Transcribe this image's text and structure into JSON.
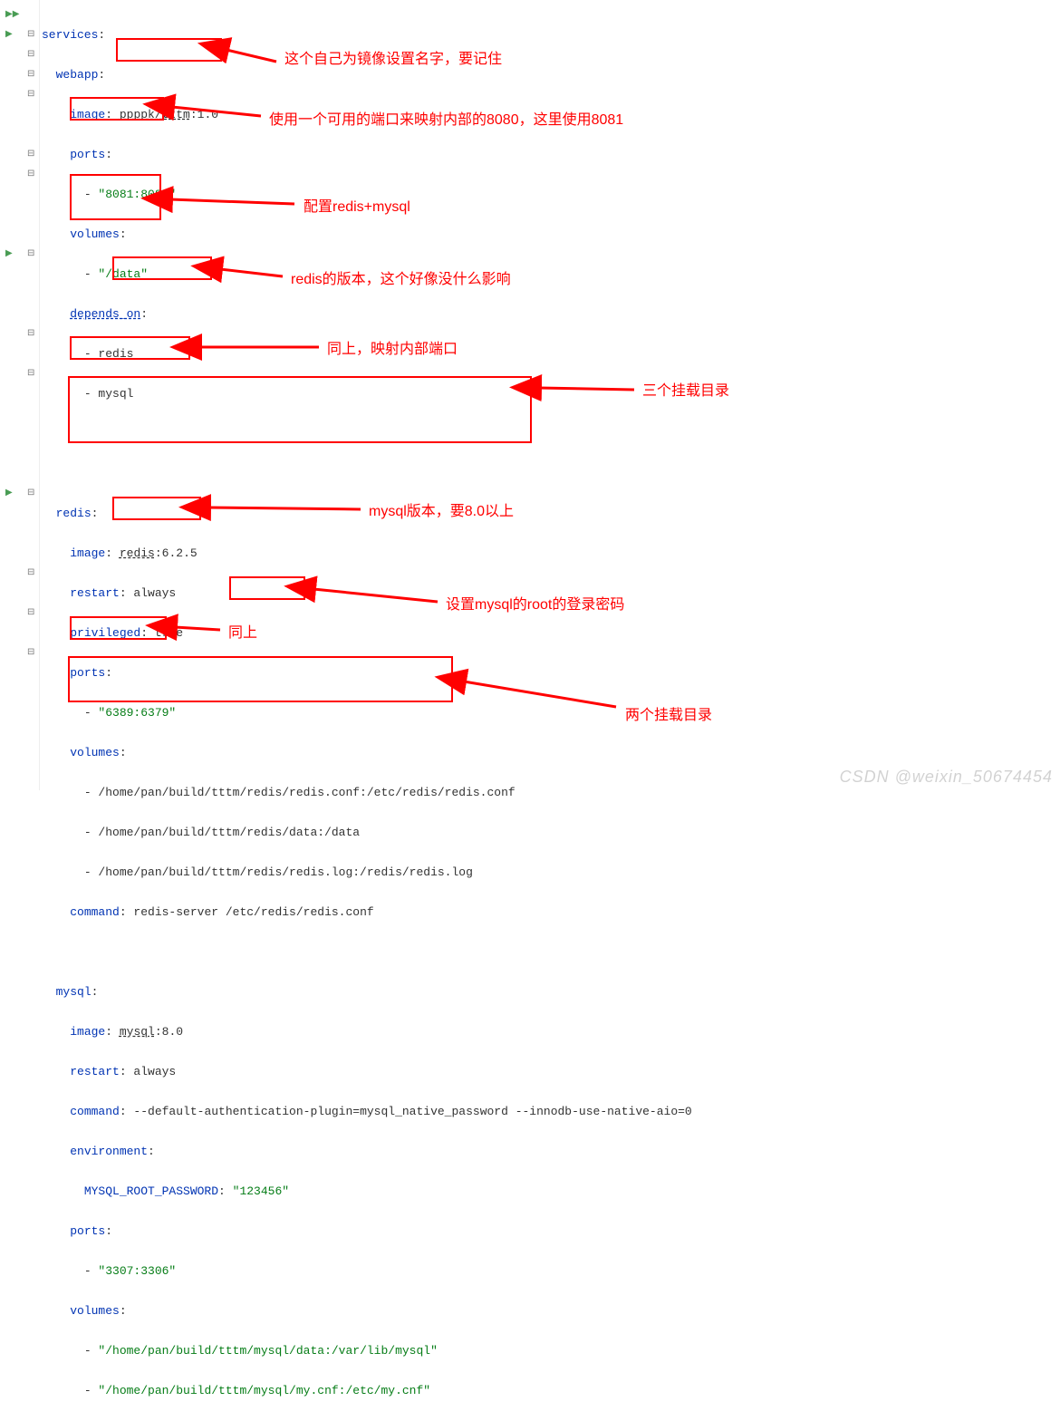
{
  "code": {
    "l0": "services",
    "l1": "webapp",
    "l2a": "image",
    "l2b": "ppppk/tttm",
    "l2c": ":1.0",
    "l3": "ports",
    "l4a": "- ",
    "l4b": "\"8081:8080\"",
    "l5": "volumes",
    "l6a": "- ",
    "l6b": "\"/data\"",
    "l7": "depends_on",
    "l8": "- redis",
    "l9": "- mysql",
    "l10": "redis",
    "l11a": "image",
    "l11b": "redis",
    "l11c": ":6.2.5",
    "l12a": "restart",
    "l12b": ": always",
    "l13a": "privileged",
    "l13b": ": true",
    "l14": "ports",
    "l15a": "- ",
    "l15b": "\"6389:6379\"",
    "l16": "volumes",
    "l17": "- /home/pan/build/tttm/redis/redis.conf:/etc/redis/redis.conf",
    "l18": "- /home/pan/build/tttm/redis/data:/data",
    "l19": "- /home/pan/build/tttm/redis/redis.log:/redis/redis.log",
    "l20a": "command",
    "l20b": ": redis-server /etc/redis/redis.conf",
    "l21": "mysql",
    "l22a": "image",
    "l22b": "mysql",
    "l22c": ":8.0",
    "l23a": "restart",
    "l23b": ": always",
    "l24a": "command",
    "l24b": ": --default-authentication-plugin=mysql_native_password --innodb-use-native-aio=0",
    "l25": "environment",
    "l26a": "MYSQL_ROOT_PASSWORD",
    "l26b": "\"123456\"",
    "l27": "ports",
    "l28a": "- ",
    "l28b": "\"3307:3306\"",
    "l29": "volumes",
    "l30a": "- ",
    "l30b": "\"/home/pan/build/tttm/mysql/data:/var/lib/mysql\"",
    "l31a": "- ",
    "l31b": "\"/home/pan/build/tttm/mysql/my.cnf:/etc/my.cnf\""
  },
  "annotations": {
    "a1": "这个自己为镜像设置名字，要记住",
    "a2": "使用一个可用的端口来映射内部的8080，这里使用8081",
    "a3": "配置redis+mysql",
    "a4": "redis的版本，这个好像没什么影响",
    "a5": "同上，映射内部端口",
    "a6": "三个挂载目录",
    "a7": "mysql版本，要8.0以上",
    "a8": "设置mysql的root的登录密码",
    "a9": "同上",
    "a10": "两个挂载目录"
  },
  "watermark": "CSDN @weixin_50674454"
}
